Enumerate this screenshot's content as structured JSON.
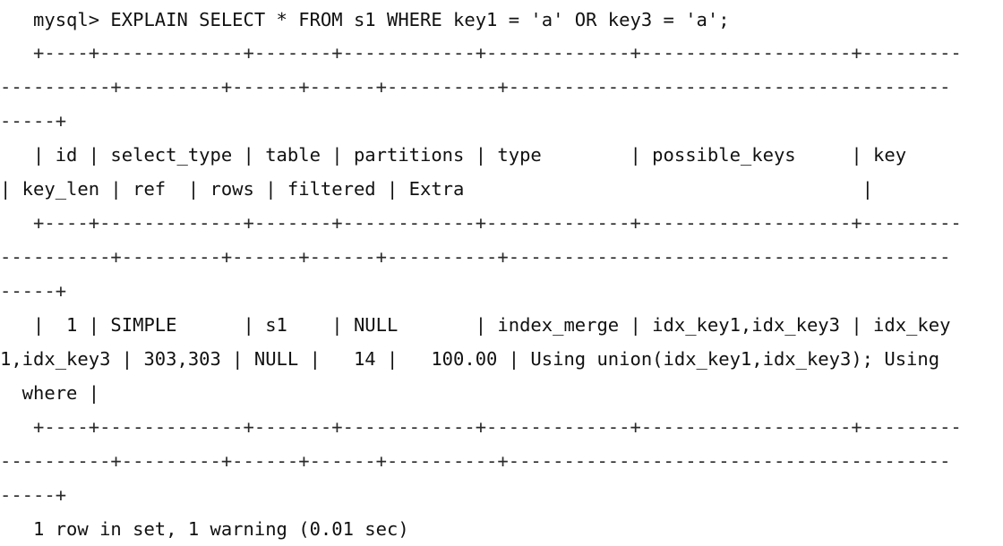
{
  "terminal": {
    "prompt": "mysql>",
    "command": "EXPLAIN SELECT * FROM s1 WHERE key1 = 'a' OR key3 = 'a';",
    "status_line": "1 row in set, 1 warning (0.01 sec)",
    "text_color": "#111111",
    "background_color": "#ffffff",
    "chars_per_line": 105,
    "indent": "  "
  },
  "result_table": {
    "columns": [
      "id",
      "select_type",
      "table",
      "partitions",
      "type",
      "possible_keys",
      "key",
      "key_len",
      "ref",
      "rows",
      "filtered",
      "Extra"
    ],
    "rows": [
      {
        "id": "1",
        "select_type": "SIMPLE",
        "table": "s1",
        "partitions": "NULL",
        "type": "index_merge",
        "possible_keys": "idx_key1,idx_key3",
        "key": "idx_key1,idx_key3",
        "key_len": "303,303",
        "ref": "NULL",
        "rows": "14",
        "filtered": "100.00",
        "Extra": "Using union(idx_key1,idx_key3); Using where"
      }
    ],
    "row_count": 1,
    "warning_count": 1,
    "duration": "0.01 sec"
  },
  "lines": {
    "l01": "   mysql> EXPLAIN SELECT * FROM s1 WHERE key1 = 'a' OR key3 = 'a';",
    "l02": "   +----+-------------+-------+------------+-------------+-------------------+---------",
    "l03": "----------+---------+------+------+----------+----------------------------------------",
    "l04": "-----+",
    "l05": "   | id | select_type | table | partitions | type        | possible_keys     | key     ",
    "l06": "| key_len | ref  | rows | filtered | Extra                                    |",
    "l07": "   +----+-------------+-------+------------+-------------+-------------------+---------",
    "l08": "----------+---------+------+------+----------+----------------------------------------",
    "l09": "-----+",
    "l10": "   |  1 | SIMPLE      | s1    | NULL       | index_merge | idx_key1,idx_key3 | idx_key",
    "l11": "1,idx_key3 | 303,303 | NULL |   14 |   100.00 | Using union(idx_key1,idx_key3); Using",
    "l12": "  where |",
    "l13": "   +----+-------------+-------+------------+-------------+-------------------+---------",
    "l14": "----------+---------+------+------+----------+----------------------------------------",
    "l15": "-----+",
    "l16": "   1 row in set, 1 warning (0.01 sec)"
  }
}
